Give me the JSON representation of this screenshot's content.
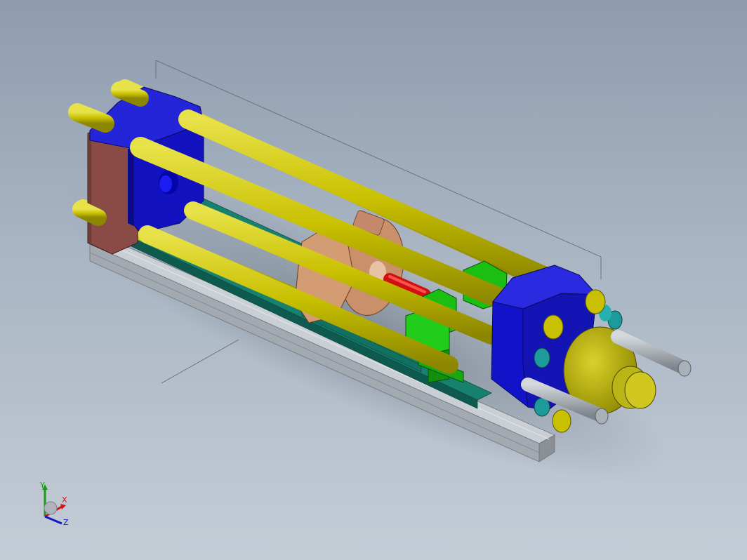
{
  "viewport": {
    "background_top": "#8e9cae",
    "background_bottom": "#c4ccd6"
  },
  "model": {
    "parts": [
      "base-rail",
      "fixed-platen",
      "moving-platen",
      "end-plate",
      "tie-bar",
      "clamp-nut",
      "injection-barrel",
      "hopper-block",
      "nozzle-housing"
    ],
    "colors": {
      "platen": "#1212c8",
      "end_plate": "#8a4a45",
      "tie_bar": "#c8c000",
      "rail": "#137a6a",
      "base": "#b9bfc6",
      "nut": "#c99069",
      "block": "#1bbf14",
      "heater": "#d01010",
      "bolt": "#1f9a9a",
      "housing": "#b5ad10",
      "rod": "#9aa1a8"
    }
  },
  "triad": {
    "x_label": "X",
    "y_label": "Y",
    "z_label": "Z",
    "x_color": "#d01515",
    "y_color": "#15a015",
    "z_color": "#1515c8"
  }
}
